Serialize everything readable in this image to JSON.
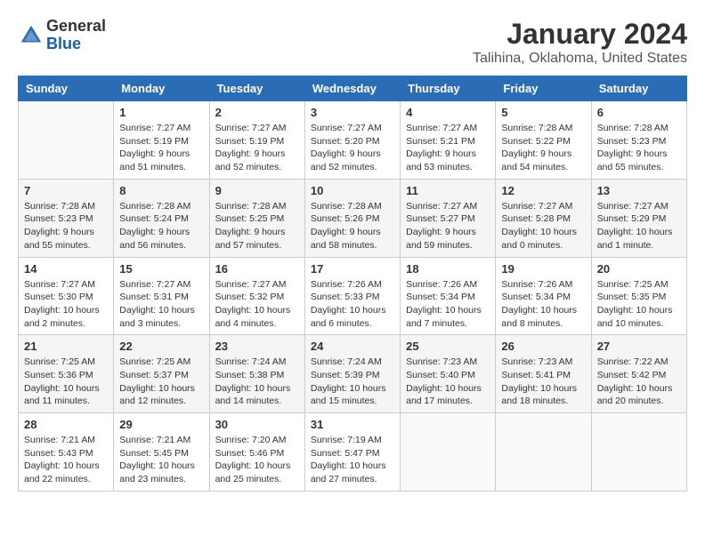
{
  "logo": {
    "general": "General",
    "blue": "Blue"
  },
  "title": "January 2024",
  "subtitle": "Talihina, Oklahoma, United States",
  "days_of_week": [
    "Sunday",
    "Monday",
    "Tuesday",
    "Wednesday",
    "Thursday",
    "Friday",
    "Saturday"
  ],
  "weeks": [
    [
      {
        "day": "",
        "info": ""
      },
      {
        "day": "1",
        "info": "Sunrise: 7:27 AM\nSunset: 5:19 PM\nDaylight: 9 hours and 51 minutes."
      },
      {
        "day": "2",
        "info": "Sunrise: 7:27 AM\nSunset: 5:19 PM\nDaylight: 9 hours and 52 minutes."
      },
      {
        "day": "3",
        "info": "Sunrise: 7:27 AM\nSunset: 5:20 PM\nDaylight: 9 hours and 52 minutes."
      },
      {
        "day": "4",
        "info": "Sunrise: 7:27 AM\nSunset: 5:21 PM\nDaylight: 9 hours and 53 minutes."
      },
      {
        "day": "5",
        "info": "Sunrise: 7:28 AM\nSunset: 5:22 PM\nDaylight: 9 hours and 54 minutes."
      },
      {
        "day": "6",
        "info": "Sunrise: 7:28 AM\nSunset: 5:23 PM\nDaylight: 9 hours and 55 minutes."
      }
    ],
    [
      {
        "day": "7",
        "info": "Sunrise: 7:28 AM\nSunset: 5:23 PM\nDaylight: 9 hours and 55 minutes."
      },
      {
        "day": "8",
        "info": "Sunrise: 7:28 AM\nSunset: 5:24 PM\nDaylight: 9 hours and 56 minutes."
      },
      {
        "day": "9",
        "info": "Sunrise: 7:28 AM\nSunset: 5:25 PM\nDaylight: 9 hours and 57 minutes."
      },
      {
        "day": "10",
        "info": "Sunrise: 7:28 AM\nSunset: 5:26 PM\nDaylight: 9 hours and 58 minutes."
      },
      {
        "day": "11",
        "info": "Sunrise: 7:27 AM\nSunset: 5:27 PM\nDaylight: 9 hours and 59 minutes."
      },
      {
        "day": "12",
        "info": "Sunrise: 7:27 AM\nSunset: 5:28 PM\nDaylight: 10 hours and 0 minutes."
      },
      {
        "day": "13",
        "info": "Sunrise: 7:27 AM\nSunset: 5:29 PM\nDaylight: 10 hours and 1 minute."
      }
    ],
    [
      {
        "day": "14",
        "info": "Sunrise: 7:27 AM\nSunset: 5:30 PM\nDaylight: 10 hours and 2 minutes."
      },
      {
        "day": "15",
        "info": "Sunrise: 7:27 AM\nSunset: 5:31 PM\nDaylight: 10 hours and 3 minutes."
      },
      {
        "day": "16",
        "info": "Sunrise: 7:27 AM\nSunset: 5:32 PM\nDaylight: 10 hours and 4 minutes."
      },
      {
        "day": "17",
        "info": "Sunrise: 7:26 AM\nSunset: 5:33 PM\nDaylight: 10 hours and 6 minutes."
      },
      {
        "day": "18",
        "info": "Sunrise: 7:26 AM\nSunset: 5:34 PM\nDaylight: 10 hours and 7 minutes."
      },
      {
        "day": "19",
        "info": "Sunrise: 7:26 AM\nSunset: 5:34 PM\nDaylight: 10 hours and 8 minutes."
      },
      {
        "day": "20",
        "info": "Sunrise: 7:25 AM\nSunset: 5:35 PM\nDaylight: 10 hours and 10 minutes."
      }
    ],
    [
      {
        "day": "21",
        "info": "Sunrise: 7:25 AM\nSunset: 5:36 PM\nDaylight: 10 hours and 11 minutes."
      },
      {
        "day": "22",
        "info": "Sunrise: 7:25 AM\nSunset: 5:37 PM\nDaylight: 10 hours and 12 minutes."
      },
      {
        "day": "23",
        "info": "Sunrise: 7:24 AM\nSunset: 5:38 PM\nDaylight: 10 hours and 14 minutes."
      },
      {
        "day": "24",
        "info": "Sunrise: 7:24 AM\nSunset: 5:39 PM\nDaylight: 10 hours and 15 minutes."
      },
      {
        "day": "25",
        "info": "Sunrise: 7:23 AM\nSunset: 5:40 PM\nDaylight: 10 hours and 17 minutes."
      },
      {
        "day": "26",
        "info": "Sunrise: 7:23 AM\nSunset: 5:41 PM\nDaylight: 10 hours and 18 minutes."
      },
      {
        "day": "27",
        "info": "Sunrise: 7:22 AM\nSunset: 5:42 PM\nDaylight: 10 hours and 20 minutes."
      }
    ],
    [
      {
        "day": "28",
        "info": "Sunrise: 7:21 AM\nSunset: 5:43 PM\nDaylight: 10 hours and 22 minutes."
      },
      {
        "day": "29",
        "info": "Sunrise: 7:21 AM\nSunset: 5:45 PM\nDaylight: 10 hours and 23 minutes."
      },
      {
        "day": "30",
        "info": "Sunrise: 7:20 AM\nSunset: 5:46 PM\nDaylight: 10 hours and 25 minutes."
      },
      {
        "day": "31",
        "info": "Sunrise: 7:19 AM\nSunset: 5:47 PM\nDaylight: 10 hours and 27 minutes."
      },
      {
        "day": "",
        "info": ""
      },
      {
        "day": "",
        "info": ""
      },
      {
        "day": "",
        "info": ""
      }
    ]
  ]
}
